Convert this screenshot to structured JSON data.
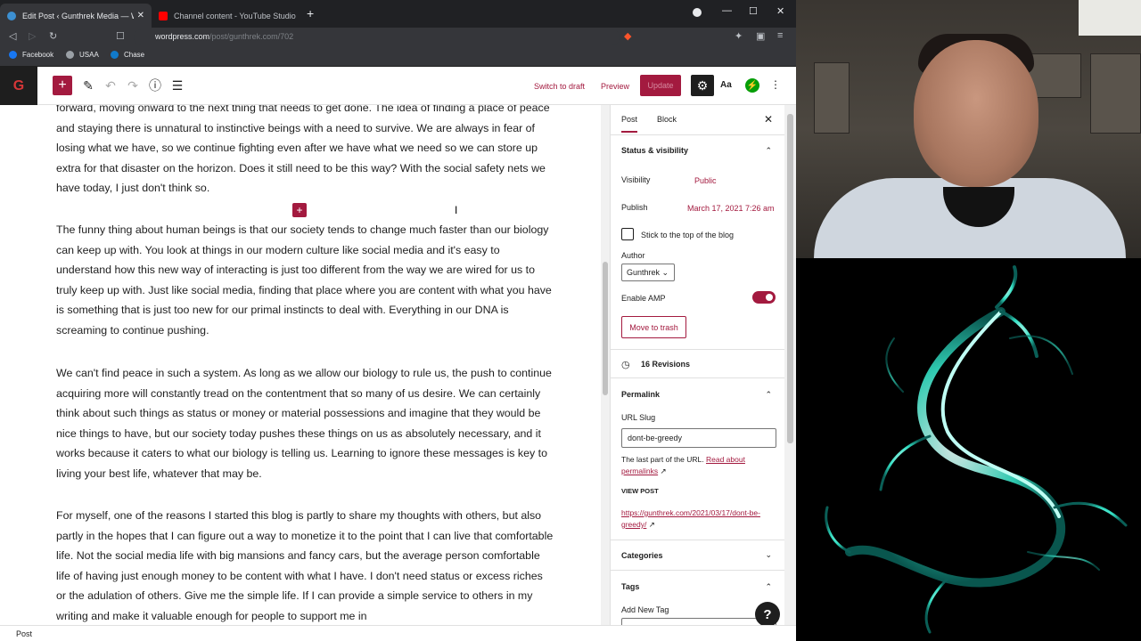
{
  "browser": {
    "tabs": [
      {
        "title": "Edit Post ‹ Gunthrek Media — W",
        "active": true
      },
      {
        "title": "Channel content - YouTube Studio",
        "active": false
      }
    ],
    "url_host": "wordpress.com",
    "url_path": "/post/gunthrek.com/702",
    "bookmarks": [
      "Facebook",
      "USAA",
      "Chase"
    ]
  },
  "header": {
    "logo": "G",
    "switch_to_draft": "Switch to draft",
    "preview": "Preview",
    "update": "Update",
    "typography": "Aa"
  },
  "editor": {
    "paragraphs": [
      "forward, moving onward to the next thing that needs to get done.  The idea of finding a place of peace and staying there is unnatural to instinctive beings with a need to survive.  We are always in fear of losing what we have, so we continue fighting even after we have what we need so we can store up extra for that disaster on the horizon.  Does it still need to be this way?  With the social safety nets we have today, I just don't think so.",
      "The funny thing about human beings is that our society tends to change much faster than our biology can keep up with.  You look at things in our modern culture like social media and it's easy to understand how this new way of interacting is just too different from the way we are wired for us to truly keep up with.  Just like social media, finding that place where you are content with what you have is something that is just too new for our primal instincts to deal with.  Everything in our DNA is screaming to continue pushing.",
      "We can't find peace in such a system.  As long as we allow our biology to rule us, the push to continue acquiring more will constantly tread on the contentment that so many of us desire.  We can certainly think about such things as status or money or material possessions and imagine that they would be nice things to have, but our society today pushes these things on us as absolutely necessary, and it works because it caters to what our biology is telling us.  Learning to ignore these messages is key to living your best life, whatever that may be.",
      "For myself, one of the reasons I started this blog is partly to share my thoughts with others, but also partly in the hopes that I can figure out a way to monetize it to the point that I can live that comfortable life.  Not the social media life with big mansions and fancy cars, but the average person comfortable life of having just enough money to be content with what I have.  I don't need status or excess riches or the adulation of others.  Give me the simple life.  If I can provide a simple service to others in my writing and make it valuable enough for people to support me in"
    ]
  },
  "sidebar": {
    "tab_post": "Post",
    "tab_block": "Block",
    "status_title": "Status & visibility",
    "visibility_label": "Visibility",
    "visibility_value": "Public",
    "publish_label": "Publish",
    "publish_value": "March 17, 2021 7:26 am",
    "sticky_label": "Stick to the top of the blog",
    "author_label": "Author",
    "author_value": "Gunthrek",
    "amp_label": "Enable AMP",
    "trash_label": "Move to trash",
    "revisions": "16 Revisions",
    "permalink_title": "Permalink",
    "slug_label": "URL Slug",
    "slug_value": "dont-be-greedy",
    "slug_help": "The last part of the URL.",
    "slug_help_link": "Read about permalinks",
    "view_post_label": "VIEW POST",
    "view_post_url": "https://gunthrek.com/2021/03/17/dont-be-greedy/",
    "categories_title": "Categories",
    "tags_title": "Tags",
    "add_tag_label": "Add New Tag"
  },
  "footer": {
    "breadcrumb": "Post"
  },
  "colors": {
    "accent": "#a31a3f",
    "chrome": "#35363a",
    "dark": "#1e1e1e"
  }
}
